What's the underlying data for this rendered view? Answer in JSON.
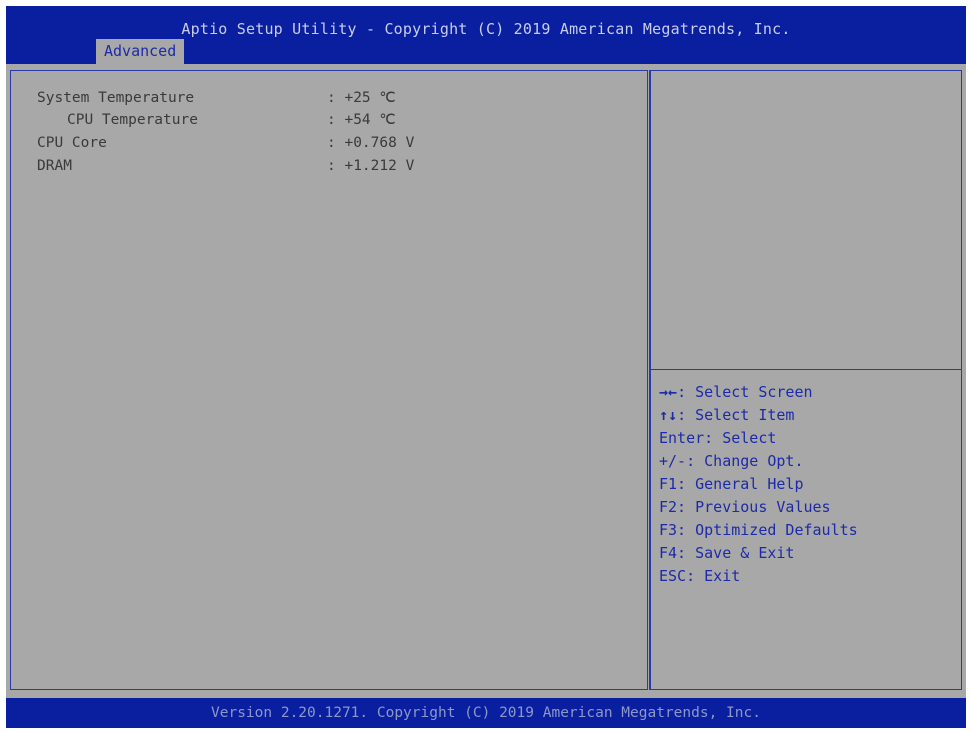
{
  "header": {
    "title": "Aptio Setup Utility - Copyright (C) 2019 American Megatrends, Inc.",
    "active_tab": "Advanced"
  },
  "main": {
    "items": [
      {
        "label": "System Temperature",
        "value": ": +25 ℃"
      },
      {
        "label": "CPU Temperature",
        "value": ": +54 ℃"
      },
      {
        "label": "CPU Core",
        "value": ": +0.768 V"
      },
      {
        "label": "DRAM",
        "value": ": +1.212 V"
      }
    ]
  },
  "help": {
    "items": [
      {
        "key": "→←",
        "text": ": Select Screen"
      },
      {
        "key": "↑↓",
        "text": ": Select Item"
      },
      {
        "key": "",
        "text": "Enter: Select"
      },
      {
        "key": "",
        "text": "+/-: Change Opt."
      },
      {
        "key": "",
        "text": "F1: General Help"
      },
      {
        "key": "",
        "text": "F2: Previous Values"
      },
      {
        "key": "",
        "text": "F3: Optimized Defaults"
      },
      {
        "key": "",
        "text": "F4: Save & Exit"
      },
      {
        "key": "",
        "text": "ESC: Exit"
      }
    ]
  },
  "footer": {
    "text": "Version 2.20.1271. Copyright (C) 2019 American Megatrends, Inc."
  },
  "colors": {
    "header_bg": "#0a1fa0",
    "panel_bg": "#a8a8a8",
    "help_text": "#1d2aa8",
    "item_text": "#3a3a3a"
  }
}
